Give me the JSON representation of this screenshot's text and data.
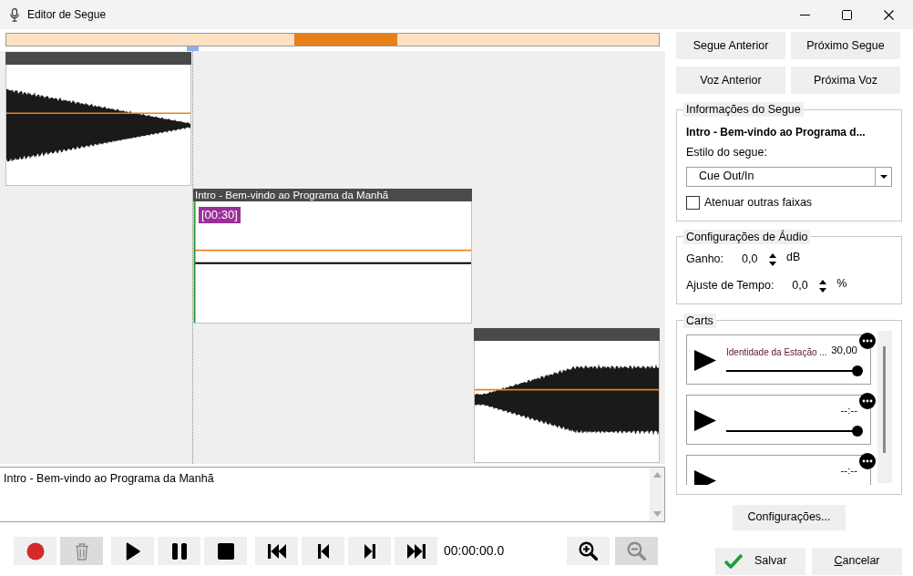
{
  "window": {
    "title": "Editor de Segue"
  },
  "timeline": {
    "clips": [
      {
        "kind": "fade_out"
      },
      {
        "kind": "silent",
        "title": "Intro - Bem-vindo ao Programa da Manhã",
        "marker": "[00:30]"
      },
      {
        "kind": "fade_in"
      }
    ]
  },
  "notes": {
    "value": "Intro - Bem-vindo ao Programa da Manhã"
  },
  "transport": {
    "groups": [
      [
        {
          "kind": "record",
          "disabled": false
        },
        {
          "kind": "delete",
          "disabled": true
        }
      ],
      [
        {
          "kind": "play",
          "disabled": false
        },
        {
          "kind": "pause",
          "disabled": false
        },
        {
          "kind": "stop",
          "disabled": false
        }
      ],
      [
        {
          "kind": "first",
          "disabled": false
        },
        {
          "kind": "previous",
          "disabled": false
        },
        {
          "kind": "next",
          "disabled": false
        },
        {
          "kind": "last",
          "disabled": false
        }
      ]
    ],
    "time": "00:00:00.0",
    "zoom": [
      {
        "kind": "zoom_in",
        "disabled": false
      },
      {
        "kind": "zoom_out",
        "disabled": true
      }
    ]
  },
  "nav_buttons": [
    "Segue Anterior",
    "Próximo Segue",
    "Voz Anterior",
    "Próxima Voz"
  ],
  "segue_info": {
    "legend": "Informações do Segue",
    "title": "Intro - Bem-vindo ao Programa d...",
    "style_label": "Estilo do segue:",
    "style_value": "Cue Out/In",
    "dim_others": {
      "label": "Atenuar outras faixas",
      "checked": false
    }
  },
  "audio_settings": {
    "legend": "Configurações de Áudio",
    "fields": [
      {
        "label": "Ganho:",
        "value": "0,0",
        "unit": "dB"
      },
      {
        "label": "Ajuste de Tempo:",
        "value": "0,0",
        "unit": "%"
      }
    ]
  },
  "carts": {
    "legend": "Carts",
    "items": [
      {
        "title": "Identidade da Estação ...",
        "time": "30,00",
        "level": 1
      },
      {
        "time": "--:--",
        "level": 1
      },
      {
        "time": "--:--"
      }
    ]
  },
  "settings_button": "Configurações...",
  "dialog_buttons": [
    {
      "kind": "save",
      "label": "Salvar",
      "access_key": false
    },
    {
      "kind": "cancel",
      "label": "Cancelar",
      "access_key": true
    }
  ]
}
